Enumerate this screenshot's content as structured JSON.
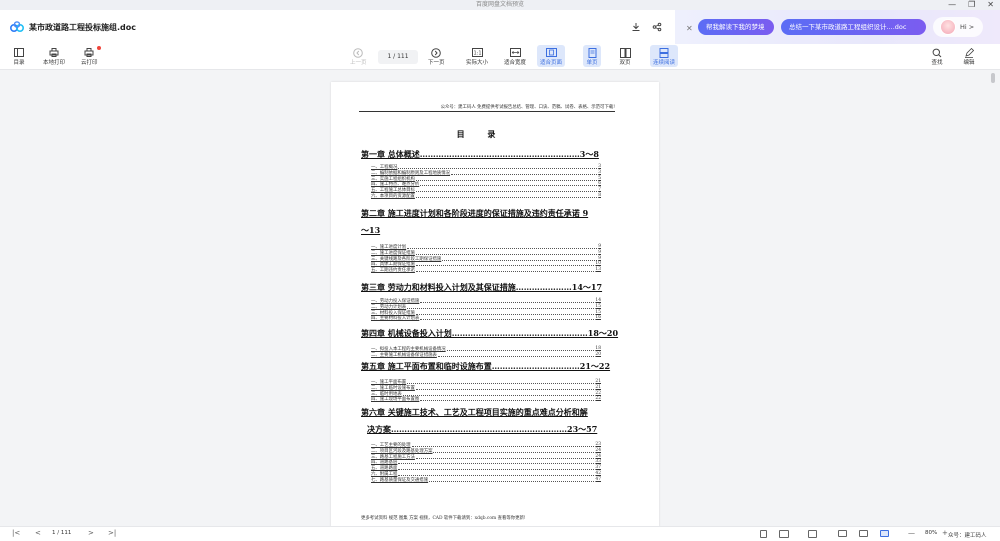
{
  "window": {
    "title": "百度网盘文档预览",
    "controls": [
      "—",
      "❐",
      "✕"
    ]
  },
  "header": {
    "doc_title": "某市政道路工程投标施组.doc",
    "ai_pills": [
      "帮我解读下我的梦境",
      "总结一下某市政道路工程组织设计....doc"
    ],
    "hi_label": "Hi >"
  },
  "toolbar": {
    "catalog": "目录",
    "local_print": "本地打印",
    "cloud_print": "云打印",
    "prev_page": "上一页",
    "page_indicator": "1 / 111",
    "next_page": "下一页",
    "actual_size": "实际大小",
    "fit_width": "适合宽度",
    "fit_page": "适合页面",
    "single_page": "单页",
    "double_page": "双页",
    "continuous": "连续阅读",
    "search": "查找",
    "edit": "编辑"
  },
  "document": {
    "header_line": "公众号：建工码人  免费提供考试报告总结、管理、口诀、范稿、试卷、表格、示范可下载!",
    "toc_title": "目 录",
    "chapters": [
      {
        "title": "第一章 总体概述",
        "dots": "……………………………………………………",
        "pages": "3～8",
        "items": [
          [
            "一、工程概况",
            "3"
          ],
          [
            "二、编制依据和编制原则及工程地质情况",
            "3"
          ],
          [
            "三、实施工程组织机构",
            "5"
          ],
          [
            "四、施工特点、难点分析",
            "6"
          ],
          [
            "五、工程施工总体目标",
            "7"
          ],
          [
            "六、本项目的资源配置",
            "8"
          ]
        ]
      },
      {
        "title": "第二章 施工进度计划和各阶段进度的保证措施及违约责任承诺 9",
        "title2": "～13",
        "items": [
          [
            "一、施工进度计划",
            "9"
          ],
          [
            "二、施工进度保证措施",
            "9"
          ],
          [
            "三、关键线路及各阶段工期保证措施",
            "9"
          ],
          [
            "四、具体工期保证措施",
            "10"
          ],
          [
            "五、工期违约责任承诺",
            "13"
          ]
        ]
      },
      {
        "title": "第三章 劳动力和材料投入计划及其保证措施",
        "dots": "…………………",
        "pages": "14～17",
        "items": [
          [
            "一、劳动力投入保证措施",
            "14"
          ],
          [
            "二、劳动力计划表",
            "15"
          ],
          [
            "三、材料投入保证措施",
            "15"
          ],
          [
            "四、主要材料投入计划表",
            "16"
          ]
        ]
      },
      {
        "title": "第四章 机械设备投入计划",
        "dots": "……………………………………………",
        "pages": "18～20",
        "items": [
          [
            "一、拟投入本工程的主要机械设备情况",
            "18"
          ],
          [
            "二、主要施工机械设备保证措施表",
            "20"
          ]
        ]
      },
      {
        "title": "第五章 施工平面布置和临时设施布置",
        "dots": "……………………………",
        "pages": "21～22",
        "items": [
          [
            "一、施工平面布置",
            "21"
          ],
          [
            "二、施工临时设施布置",
            "21"
          ],
          [
            "三、临时用地表",
            "22"
          ],
          [
            "四、施工现场平面布置图",
            "22"
          ]
        ]
      },
      {
        "title": "第六章 关键施工技术、工艺及工程项目实施的重点难点分析和解",
        "title2": "决方案",
        "dots": "…………………………………………………………",
        "pages": "23～57",
        "items": [
          [
            "一、工艺主要的处理",
            "23"
          ],
          [
            "二、项目区河段及路基处理方案",
            "24"
          ],
          [
            "三、路基工程施工方法",
            "24"
          ],
          [
            "四、道路基层",
            "33"
          ],
          [
            "五、道路路面",
            "37"
          ],
          [
            "六、附属工程",
            "42"
          ],
          [
            "七、路基质量保证及交通措施",
            "47"
          ]
        ]
      }
    ],
    "footer_line": "更多考试资料 规范 图集 方案 视频，CAD 软件下载请到：xdqb.com 查看等你更新!"
  },
  "bottombar": {
    "page_indicator": "1 / 111",
    "zoom": "80%",
    "watermark": "众号：建工码人"
  }
}
